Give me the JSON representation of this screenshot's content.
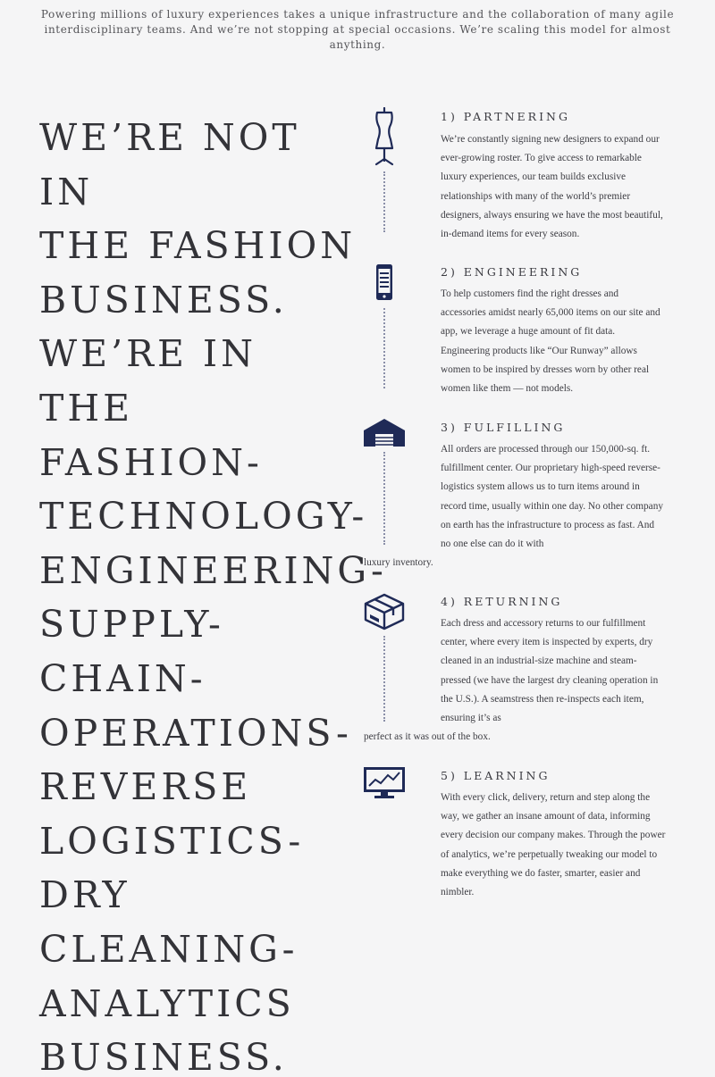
{
  "intro": "Powering millions of luxury experiences takes a unique infrastructure and the collaboration of many agile interdisciplinary teams. And we’re not stopping at special occasions. We’re scaling this model for almost anything.",
  "headline": [
    "WE’RE NOT",
    "IN",
    "THE FASHION",
    "BUSINESS.",
    "WE’RE IN",
    "THE",
    "FASHION-",
    "TECHNOLOGY-",
    "ENGINEERING-",
    "SUPPLY-",
    "CHAIN-",
    "OPERATIONS-",
    "REVERSE",
    "LOGISTICS-",
    "DRY",
    "CLEANING-",
    "ANALYTICS",
    "BUSINESS."
  ],
  "steps": [
    {
      "icon": "dress-form-icon",
      "title": "1) PARTNERING",
      "body": "We’re constantly signing new designers to expand our ever-growing roster. To give access to remarkable luxury experiences, our team builds exclusive relationships with many of the world’s premier designers, always ensuring we have the most beautiful, in-demand items for every season.",
      "tail": ""
    },
    {
      "icon": "smartphone-icon",
      "title": "2) ENGINEERING",
      "body": "To help customers find the right dresses and accessories amidst nearly 65,000 items on our site and app, we leverage a huge amount of fit data. Engineering products like “Our Runway” allows women to be inspired by dresses worn by other real women like them — not models.",
      "tail": ""
    },
    {
      "icon": "warehouse-icon",
      "title": "3) FULFILLING",
      "body": "All orders are processed through our 150,000-sq. ft. fulfillment center. Our proprietary high-speed reverse-logistics system allows us to turn items around in record time, usually within one day. No other company on earth has the infrastructure to process as fast. And no one else can do it with",
      "tail": "luxury inventory."
    },
    {
      "icon": "package-box-icon",
      "title": "4) RETURNING",
      "body": "Each dress and accessory returns to our fulfillment center, where every item is inspected by experts, dry cleaned in an industrial-size machine and steam-pressed (we have the largest dry cleaning operation in the U.S.). A seamstress then re-inspects each item, ensuring it’s as",
      "tail": "perfect as it was out of the box."
    },
    {
      "icon": "analytics-monitor-icon",
      "title": "5) LEARNING",
      "body": "With every click, delivery, return and step along the way, we gather an insane amount of data, informing every decision our company makes. Through the power of analytics, we’re perpetually tweaking our model to make everything we do faster, smarter, easier and nimbler.",
      "tail": ""
    }
  ],
  "colors": {
    "background": "#f5f5f6",
    "icon_navy": "#1f2a57",
    "text": "#333338"
  }
}
